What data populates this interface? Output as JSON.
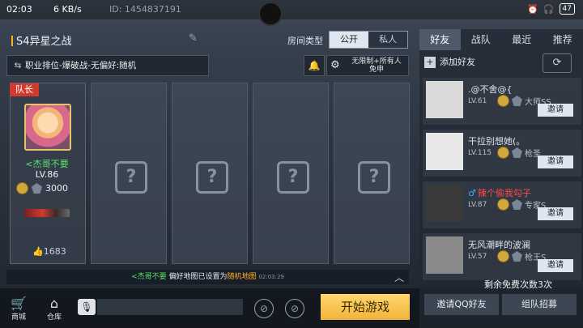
{
  "status_bar": {
    "time": "02:03",
    "speed": "6 KB/s",
    "uid": "ID: 1454837191",
    "battery": "47"
  },
  "header": {
    "title": "S4异星之战",
    "room_type_label": "房间类型",
    "public_label": "公开",
    "private_label": "私人"
  },
  "mode_row": {
    "text": "职业排位-爆破战-无偏好:随机"
  },
  "settings": {
    "line1": "无限制+所有人",
    "line2": "免申"
  },
  "leader": {
    "tag": "队长",
    "name": "<杰哥不要",
    "level": "LV.86",
    "points": "3000",
    "likes": "1683"
  },
  "notice": {
    "name": "<杰哥不要",
    "text": "偏好地图已设置为",
    "map": "随机地图",
    "time": "02:03:29"
  },
  "bottom_bar": {
    "shop": "商城",
    "warehouse": "仓库",
    "start": "开始游戏"
  },
  "right_panel": {
    "tabs": [
      "好友",
      "战队",
      "最近",
      "推荐"
    ],
    "active_tab": "好友",
    "add_friend": "添加好友",
    "invite_label": "邀请",
    "friends": [
      {
        "name": ".@不舍@{",
        "level": "LV.61",
        "rank": "大师SS",
        "male": false,
        "name_color": "#e0e4ea"
      },
      {
        "name": "干拉别想她(。",
        "level": "LV.115",
        "rank": "枪圣",
        "male": false,
        "name_color": "#e0e4ea"
      },
      {
        "name": "辣个偷我勾子",
        "level": "LV.87",
        "rank": "专家S",
        "male": true,
        "name_color": "#ff4a4a"
      },
      {
        "name": "无风潮畔的波澜",
        "level": "LV.57",
        "rank": "枪王S",
        "male": false,
        "name_color": "#e0e4ea"
      }
    ],
    "free_count": "剩余免费次数3次",
    "invite_qq": "邀请QQ好友",
    "recruit": "组队招募"
  }
}
